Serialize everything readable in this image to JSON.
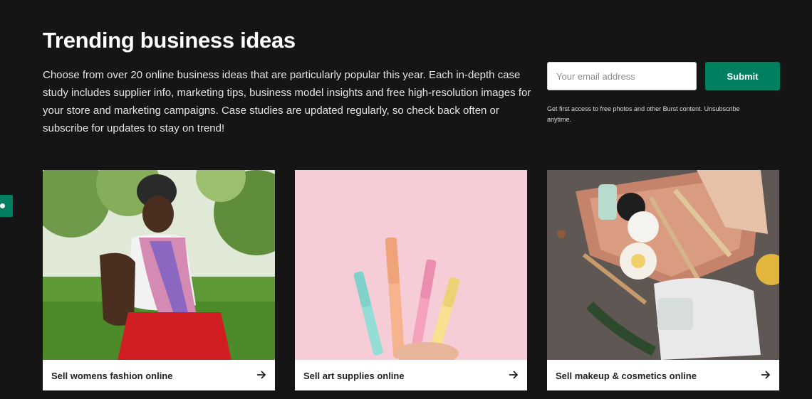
{
  "heading": "Trending business ideas",
  "intro": "Choose from over 20 online business ideas that are particularly popular this year. Each in-depth case study includes supplier info, marketing tips, business model insights and free high-resolution images for your store and marketing campaigns. Case studies are updated regularly, so check back often or subscribe for updates to stay on trend!",
  "subscribe": {
    "email_placeholder": "Your email address",
    "email_value": "",
    "submit_label": "Submit",
    "fineprint": "Get first access to free photos and other Burst content. Unsubscribe anytime."
  },
  "cards": [
    {
      "title": "Sell womens fashion online",
      "icon": "arrow-right-icon"
    },
    {
      "title": "Sell art supplies online",
      "icon": "arrow-right-icon"
    },
    {
      "title": "Sell makeup & cosmetics online",
      "icon": "arrow-right-icon"
    }
  ],
  "colors": {
    "background": "#151515",
    "accent": "#008060",
    "card": "#ffffff"
  }
}
